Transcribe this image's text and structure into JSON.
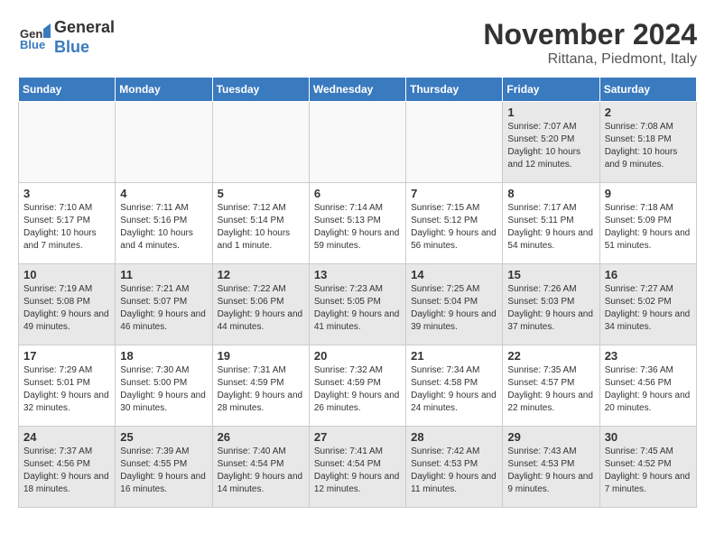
{
  "header": {
    "logo_line1": "General",
    "logo_line2": "Blue",
    "month": "November 2024",
    "location": "Rittana, Piedmont, Italy"
  },
  "days_of_week": [
    "Sunday",
    "Monday",
    "Tuesday",
    "Wednesday",
    "Thursday",
    "Friday",
    "Saturday"
  ],
  "weeks": [
    [
      {
        "day": "",
        "info": ""
      },
      {
        "day": "",
        "info": ""
      },
      {
        "day": "",
        "info": ""
      },
      {
        "day": "",
        "info": ""
      },
      {
        "day": "",
        "info": ""
      },
      {
        "day": "1",
        "info": "Sunrise: 7:07 AM\nSunset: 5:20 PM\nDaylight: 10 hours and 12 minutes."
      },
      {
        "day": "2",
        "info": "Sunrise: 7:08 AM\nSunset: 5:18 PM\nDaylight: 10 hours and 9 minutes."
      }
    ],
    [
      {
        "day": "3",
        "info": "Sunrise: 7:10 AM\nSunset: 5:17 PM\nDaylight: 10 hours and 7 minutes."
      },
      {
        "day": "4",
        "info": "Sunrise: 7:11 AM\nSunset: 5:16 PM\nDaylight: 10 hours and 4 minutes."
      },
      {
        "day": "5",
        "info": "Sunrise: 7:12 AM\nSunset: 5:14 PM\nDaylight: 10 hours and 1 minute."
      },
      {
        "day": "6",
        "info": "Sunrise: 7:14 AM\nSunset: 5:13 PM\nDaylight: 9 hours and 59 minutes."
      },
      {
        "day": "7",
        "info": "Sunrise: 7:15 AM\nSunset: 5:12 PM\nDaylight: 9 hours and 56 minutes."
      },
      {
        "day": "8",
        "info": "Sunrise: 7:17 AM\nSunset: 5:11 PM\nDaylight: 9 hours and 54 minutes."
      },
      {
        "day": "9",
        "info": "Sunrise: 7:18 AM\nSunset: 5:09 PM\nDaylight: 9 hours and 51 minutes."
      }
    ],
    [
      {
        "day": "10",
        "info": "Sunrise: 7:19 AM\nSunset: 5:08 PM\nDaylight: 9 hours and 49 minutes."
      },
      {
        "day": "11",
        "info": "Sunrise: 7:21 AM\nSunset: 5:07 PM\nDaylight: 9 hours and 46 minutes."
      },
      {
        "day": "12",
        "info": "Sunrise: 7:22 AM\nSunset: 5:06 PM\nDaylight: 9 hours and 44 minutes."
      },
      {
        "day": "13",
        "info": "Sunrise: 7:23 AM\nSunset: 5:05 PM\nDaylight: 9 hours and 41 minutes."
      },
      {
        "day": "14",
        "info": "Sunrise: 7:25 AM\nSunset: 5:04 PM\nDaylight: 9 hours and 39 minutes."
      },
      {
        "day": "15",
        "info": "Sunrise: 7:26 AM\nSunset: 5:03 PM\nDaylight: 9 hours and 37 minutes."
      },
      {
        "day": "16",
        "info": "Sunrise: 7:27 AM\nSunset: 5:02 PM\nDaylight: 9 hours and 34 minutes."
      }
    ],
    [
      {
        "day": "17",
        "info": "Sunrise: 7:29 AM\nSunset: 5:01 PM\nDaylight: 9 hours and 32 minutes."
      },
      {
        "day": "18",
        "info": "Sunrise: 7:30 AM\nSunset: 5:00 PM\nDaylight: 9 hours and 30 minutes."
      },
      {
        "day": "19",
        "info": "Sunrise: 7:31 AM\nSunset: 4:59 PM\nDaylight: 9 hours and 28 minutes."
      },
      {
        "day": "20",
        "info": "Sunrise: 7:32 AM\nSunset: 4:59 PM\nDaylight: 9 hours and 26 minutes."
      },
      {
        "day": "21",
        "info": "Sunrise: 7:34 AM\nSunset: 4:58 PM\nDaylight: 9 hours and 24 minutes."
      },
      {
        "day": "22",
        "info": "Sunrise: 7:35 AM\nSunset: 4:57 PM\nDaylight: 9 hours and 22 minutes."
      },
      {
        "day": "23",
        "info": "Sunrise: 7:36 AM\nSunset: 4:56 PM\nDaylight: 9 hours and 20 minutes."
      }
    ],
    [
      {
        "day": "24",
        "info": "Sunrise: 7:37 AM\nSunset: 4:56 PM\nDaylight: 9 hours and 18 minutes."
      },
      {
        "day": "25",
        "info": "Sunrise: 7:39 AM\nSunset: 4:55 PM\nDaylight: 9 hours and 16 minutes."
      },
      {
        "day": "26",
        "info": "Sunrise: 7:40 AM\nSunset: 4:54 PM\nDaylight: 9 hours and 14 minutes."
      },
      {
        "day": "27",
        "info": "Sunrise: 7:41 AM\nSunset: 4:54 PM\nDaylight: 9 hours and 12 minutes."
      },
      {
        "day": "28",
        "info": "Sunrise: 7:42 AM\nSunset: 4:53 PM\nDaylight: 9 hours and 11 minutes."
      },
      {
        "day": "29",
        "info": "Sunrise: 7:43 AM\nSunset: 4:53 PM\nDaylight: 9 hours and 9 minutes."
      },
      {
        "day": "30",
        "info": "Sunrise: 7:45 AM\nSunset: 4:52 PM\nDaylight: 9 hours and 7 minutes."
      }
    ]
  ]
}
